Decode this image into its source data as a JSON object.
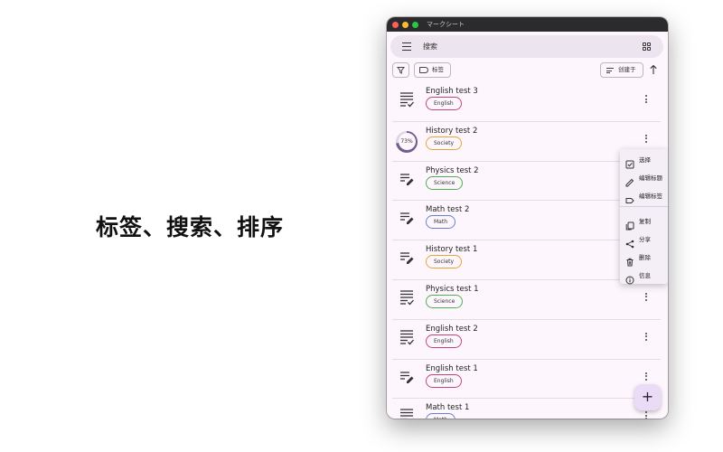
{
  "headline": "标签、搜索、排序",
  "window": {
    "title": "マークシート"
  },
  "search": {
    "text": "搜索"
  },
  "toolbar": {
    "tag_label": "标签",
    "sort_label": "创建于"
  },
  "items": [
    {
      "title": "English test 3",
      "tag": "English",
      "tag_color": "#c8427a",
      "icon": "list-check-icon"
    },
    {
      "title": "History test 2",
      "tag": "Society",
      "tag_color": "#e8a23a",
      "icon": "progress-ring",
      "progress": "73%"
    },
    {
      "title": "Physics test 2",
      "tag": "Science",
      "tag_color": "#4caf50",
      "icon": "edit-list-icon"
    },
    {
      "title": "Math test 2",
      "tag": "Math",
      "tag_color": "#6b7fd0",
      "icon": "edit-list-icon"
    },
    {
      "title": "History test 1",
      "tag": "Society",
      "tag_color": "#e8a23a",
      "icon": "edit-list-icon"
    },
    {
      "title": "Physics test 1",
      "tag": "Science",
      "tag_color": "#4caf50",
      "icon": "list-check-icon"
    },
    {
      "title": "English test 2",
      "tag": "English",
      "tag_color": "#c8427a",
      "icon": "list-check-icon"
    },
    {
      "title": "English test 1",
      "tag": "English",
      "tag_color": "#c8427a",
      "icon": "edit-list-icon"
    },
    {
      "title": "Math test 1",
      "tag": "Math",
      "tag_color": "#6b7fd0",
      "icon": "list-check-icon"
    }
  ],
  "context_menu": {
    "items": [
      {
        "label": "选择",
        "icon": "checkbox-icon"
      },
      {
        "label": "编辑标题",
        "icon": "pencil-icon"
      },
      {
        "label": "编辑标签",
        "icon": "tag-icon"
      },
      {
        "label": "复制",
        "icon": "copy-icon"
      },
      {
        "label": "分享",
        "icon": "share-icon"
      },
      {
        "label": "删除",
        "icon": "trash-icon"
      },
      {
        "label": "信息",
        "icon": "info-icon"
      }
    ]
  },
  "fab": {
    "label": "+"
  }
}
